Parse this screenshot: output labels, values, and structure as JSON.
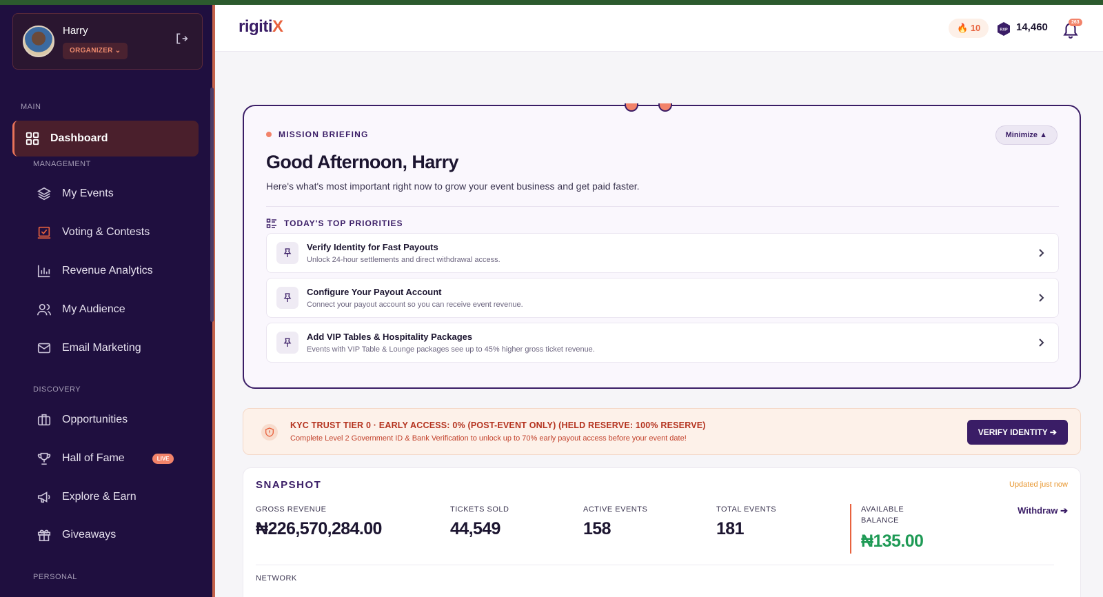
{
  "user": {
    "name": "Harry",
    "role": "ORGANIZER"
  },
  "sidebar": {
    "sections": {
      "main": "MAIN",
      "management": "MANAGEMENT",
      "discovery": "DISCOVERY",
      "personal": "PERSONAL"
    },
    "items": {
      "dashboard": "Dashboard",
      "my_events": "My Events",
      "voting": "Voting & Contests",
      "revenue": "Revenue Analytics",
      "audience": "My Audience",
      "email": "Email Marketing",
      "opportunities": "Opportunities",
      "hall_of_fame": "Hall of Fame",
      "explore": "Explore & Earn",
      "giveaways": "Giveaways"
    },
    "live_badge": "LIVE"
  },
  "header": {
    "logo_main": "rigiti",
    "logo_accent": "X",
    "streak": "10",
    "xp_icon_label": "RXP",
    "xp": "14,460",
    "notifications": "263"
  },
  "mission": {
    "label": "MISSION BRIEFING",
    "minimize": "Minimize ▲",
    "greeting": "Good Afternoon, Harry",
    "subtitle": "Here's what's most important right now to grow your event business and get paid faster.",
    "priorities_label": "TODAY'S TOP PRIORITIES",
    "priorities": [
      {
        "title": "Verify Identity for Fast Payouts",
        "desc": "Unlock 24-hour settlements and direct withdrawal access."
      },
      {
        "title": "Configure Your Payout Account",
        "desc": "Connect your payout account so you can receive event revenue."
      },
      {
        "title": "Add VIP Tables & Hospitality Packages",
        "desc": "Events with VIP Table & Lounge packages see up to 45% higher gross ticket revenue."
      }
    ]
  },
  "kyc": {
    "title": "KYC TRUST TIER 0 · EARLY ACCESS: 0% (POST-EVENT ONLY) (HELD RESERVE: 100% RESERVE)",
    "desc": "Complete Level 2 Government ID & Bank Verification to unlock up to 70% early payout access before your event date!",
    "button": "VERIFY IDENTITY ➔"
  },
  "snapshot": {
    "title": "SNAPSHOT",
    "updated": "Updated just now",
    "gross_label": "GROSS REVENUE",
    "gross_value": "₦226,570,284.00",
    "tickets_label": "TICKETS SOLD",
    "tickets_value": "44,549",
    "active_label": "ACTIVE EVENTS",
    "active_value": "158",
    "total_label": "TOTAL EVENTS",
    "total_value": "181",
    "balance_label_1": "AVAILABLE",
    "balance_label_2": "BALANCE",
    "balance_value": "₦135.00",
    "withdraw": "Withdraw ➔",
    "network_label": "NETWORK"
  },
  "colors": {
    "sidebar_bg": "#1f0f3f",
    "brand": "#3a1d66",
    "accent": "#e8623e",
    "success": "#1e9a55"
  }
}
